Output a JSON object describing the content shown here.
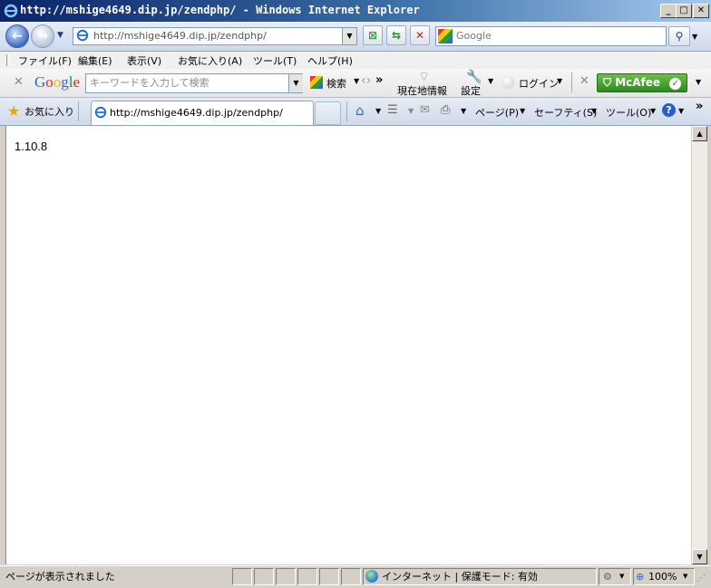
{
  "window": {
    "title": "http://mshige4649.dip.jp/zendphp/ - Windows Internet Explorer",
    "min_label": "_",
    "max_label": "□",
    "close_label": "✕"
  },
  "address": {
    "url": "http://mshige4649.dip.jp/zendphp/"
  },
  "search": {
    "placeholder": "Google"
  },
  "menu": {
    "items": [
      "ファイル(F)",
      "編集(E)",
      "表示(V)",
      "お気に入り(A)",
      "ツール(T)",
      "ヘルプ(H)"
    ]
  },
  "google_toolbar": {
    "close_label": "✕",
    "logo": "Google",
    "input_placeholder": "キーワードを入力して検索",
    "search_label": "検索",
    "more_label": "»",
    "location_label": "現在地情報",
    "settings_label": "設定",
    "login_label": "ログイン",
    "mcafee_label": "McAfee"
  },
  "favorites": {
    "label": "お気に入り"
  },
  "tab": {
    "title": "http://mshige4649.dip.jp/zendphp/"
  },
  "commands": {
    "page_label": "ページ(P)",
    "safety_label": "セーフティ(S)",
    "tools_label": "ツール(O)",
    "more_label": "»"
  },
  "content": {
    "text": "1.10.8"
  },
  "status": {
    "message": "ページが表示されました",
    "zone": "インターネット | 保護モード: 有効",
    "zoom": "100%"
  },
  "colors": {
    "title_bar": "#0a246a",
    "mcafee": "#3ea32a"
  }
}
